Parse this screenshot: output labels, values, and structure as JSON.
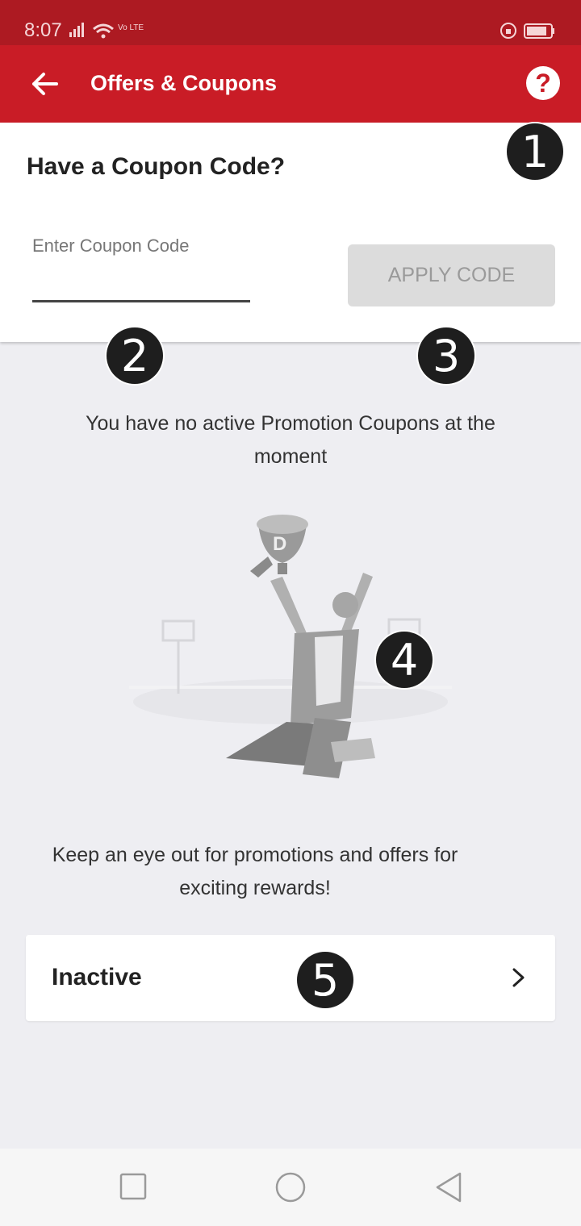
{
  "status_bar": {
    "time": "8:07",
    "network_label": "Vo LTE"
  },
  "app_bar": {
    "title": "Offers & Coupons"
  },
  "coupon": {
    "heading": "Have a Coupon Code?",
    "input_label": "Enter Coupon Code",
    "input_value": "",
    "apply_label": "APPLY CODE"
  },
  "empty_state": {
    "message": "You have no active Promotion Coupons at the moment",
    "subtext": "Keep an eye out for promotions and offers for exciting rewards!"
  },
  "inactive": {
    "label": "Inactive"
  },
  "markers": [
    "1",
    "2",
    "3",
    "4",
    "5"
  ],
  "icons": {
    "back": "arrow-left-icon",
    "help": "question-icon",
    "chevron": "chevron-right-icon",
    "nav": [
      "square-icon",
      "circle-icon",
      "triangle-back-icon"
    ]
  },
  "colors": {
    "status_bar": "#ad1a22",
    "app_bar": "#c91c26",
    "background": "#eeeef2",
    "apply_disabled_bg": "#dcdcdc",
    "marker_bg": "#1e1e1e"
  }
}
